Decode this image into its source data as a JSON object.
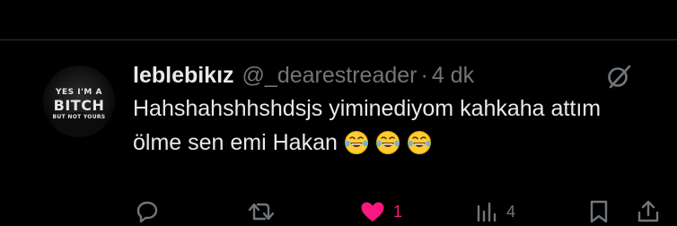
{
  "tweet": {
    "author_name": "leblebikız",
    "handle": "@_dearestreader",
    "separator": "·",
    "time": "4 dk",
    "text_line1": "Hahshahshhshdsjs yiminediyom kahkaha attım",
    "text_line2": "ölme sen emi Hakan",
    "emojis": [
      "face-with-tears-of-joy",
      "face-with-tears-of-joy",
      "face-with-tears-of-joy"
    ],
    "avatar": {
      "line1": "YES I'M A",
      "line2": "BITCH",
      "line3": "BUT NOT YOURS"
    }
  },
  "actions": {
    "reply": {
      "icon": "reply-icon"
    },
    "retweet": {
      "icon": "retweet-icon"
    },
    "like": {
      "icon": "heart-filled-icon",
      "count": "1",
      "color": "#f91880"
    },
    "views": {
      "icon": "views-icon",
      "count": "4"
    },
    "bookmark": {
      "icon": "bookmark-icon"
    },
    "share": {
      "icon": "share-icon"
    }
  },
  "colors": {
    "background": "#000000",
    "text": "#e7e9ea",
    "muted": "#71767b",
    "like": "#f91880",
    "divider": "#2f3336"
  }
}
